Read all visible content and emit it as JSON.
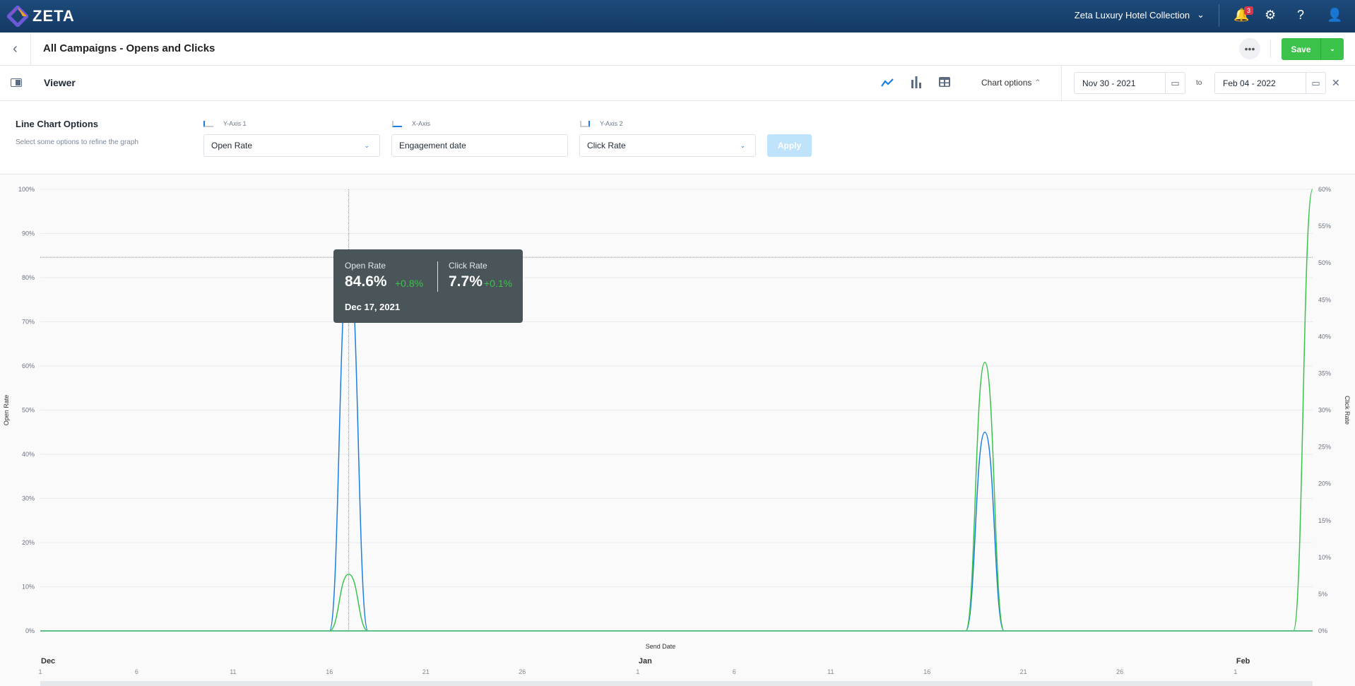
{
  "topbar": {
    "brand": "ZETA",
    "org": "Zeta Luxury Hotel Collection",
    "notifications": "3",
    "icons": [
      "bell-icon",
      "gear-icon",
      "help-icon",
      "user-icon"
    ]
  },
  "header": {
    "title": "All Campaigns - Opens and Clicks",
    "save_label": "Save",
    "more_label": "•••"
  },
  "viewer": {
    "title": "Viewer",
    "chart_options_label": "Chart options",
    "date_from": "Nov 30 - 2021",
    "date_to": "Feb 04 - 2022",
    "to_label": "to"
  },
  "options": {
    "title": "Line Chart Options",
    "subtitle": "Select some options to refine the graph",
    "y1_label": "Y-Axis 1",
    "y1_value": "Open Rate",
    "x_label": "X-Axis",
    "x_value": "Engagement date",
    "y2_label": "Y-Axis 2",
    "y2_value": "Click Rate",
    "apply_label": "Apply"
  },
  "tooltip": {
    "open_label": "Open Rate",
    "open_value": "84.6%",
    "open_delta": "+0.8%",
    "click_label": "Click Rate",
    "click_value": "7.7%",
    "click_delta": "+0.1%",
    "date": "Dec 17, 2021"
  },
  "colors": {
    "open": "#1b7ee0",
    "click": "#3bc24b",
    "accent": "#3bc24b"
  },
  "chart_data": {
    "type": "line",
    "xlabel": "Send Date",
    "ylabel": "Open Rate",
    "y2label": "Click Rate",
    "ylim": [
      0,
      100
    ],
    "y2lim": [
      0,
      60
    ],
    "yticks": [
      "0%",
      "10%",
      "20%",
      "30%",
      "40%",
      "50%",
      "60%",
      "70%",
      "80%",
      "90%",
      "100%"
    ],
    "y2ticks": [
      "0%",
      "5%",
      "10%",
      "15%",
      "20%",
      "25%",
      "30%",
      "35%",
      "40%",
      "45%",
      "50%",
      "55%",
      "60%"
    ],
    "months": [
      {
        "label": "Dec",
        "day": 0
      },
      {
        "label": "Jan",
        "day": 31
      },
      {
        "label": "Feb",
        "day": 62
      }
    ],
    "day_ticks": [
      {
        "label": "1",
        "day": 0
      },
      {
        "label": "6",
        "day": 5
      },
      {
        "label": "11",
        "day": 10
      },
      {
        "label": "16",
        "day": 15
      },
      {
        "label": "21",
        "day": 20
      },
      {
        "label": "26",
        "day": 25
      },
      {
        "label": "1",
        "day": 31
      },
      {
        "label": "6",
        "day": 36
      },
      {
        "label": "11",
        "day": 41
      },
      {
        "label": "16",
        "day": 46
      },
      {
        "label": "21",
        "day": 51
      },
      {
        "label": "26",
        "day": 56
      },
      {
        "label": "1",
        "day": 62
      }
    ],
    "x_days": 66,
    "series": [
      {
        "name": "Open Rate",
        "axis": "left",
        "points": [
          [
            0,
            0
          ],
          [
            15,
            0
          ],
          [
            16,
            84.6
          ],
          [
            17,
            0
          ],
          [
            48,
            0
          ],
          [
            49,
            45
          ],
          [
            50,
            0
          ],
          [
            65,
            0
          ],
          [
            66,
            0
          ]
        ]
      },
      {
        "name": "Click Rate",
        "axis": "right",
        "points": [
          [
            0,
            0
          ],
          [
            15,
            0
          ],
          [
            16,
            7.7
          ],
          [
            17,
            0
          ],
          [
            48,
            0
          ],
          [
            49,
            36.5
          ],
          [
            50,
            0
          ],
          [
            65,
            0
          ],
          [
            66,
            60
          ]
        ]
      }
    ],
    "crosshair": {
      "day": 16,
      "open": 84.6
    }
  }
}
